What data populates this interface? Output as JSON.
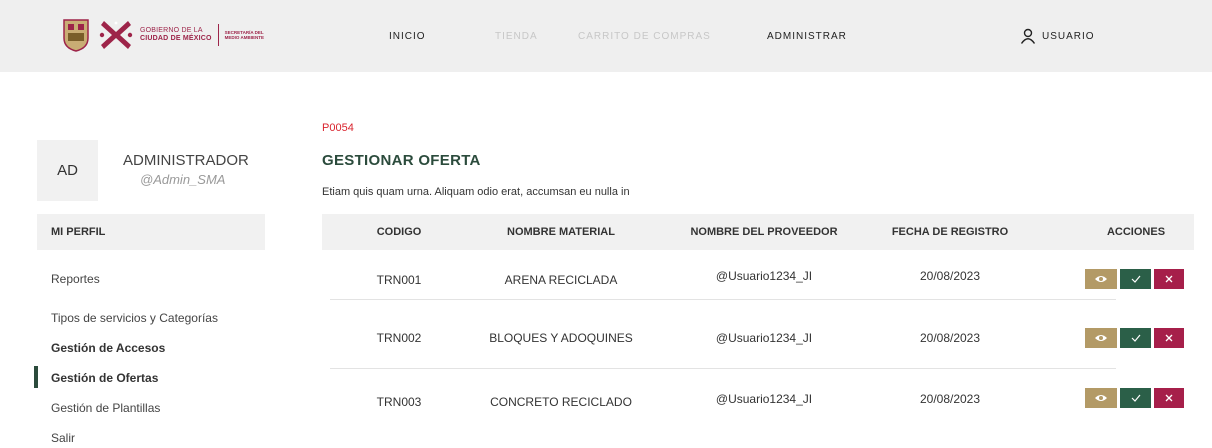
{
  "header": {
    "logo": {
      "gob_line1": "GOBIERNO DE LA",
      "gob_line2": "CIUDAD DE MÉXICO",
      "sec_line1": "SECRETARÍA DEL",
      "sec_line2": "MEDIO AMBIENTE"
    },
    "nav": [
      {
        "label": "INICIO",
        "state": "active"
      },
      {
        "label": "TIENDA",
        "state": "disabled"
      },
      {
        "label": "CARRITO DE COMPRAS",
        "state": "disabled"
      },
      {
        "label": "ADMINISTRAR",
        "state": "active"
      }
    ],
    "user_label": "USUARIO"
  },
  "sidebar": {
    "initials": "AD",
    "name": "ADMINISTRADOR",
    "handle": "@Admin_SMA",
    "section_title": "MI PERFIL",
    "items": [
      {
        "label": "Reportes"
      },
      {
        "label": "Tipos de servicios y Categorías"
      },
      {
        "label": "Gestión de Accesos"
      },
      {
        "label": "Gestión de Ofertas"
      },
      {
        "label": "Gestión de Plantillas"
      },
      {
        "label": "Salir"
      }
    ]
  },
  "main": {
    "code": "P0054",
    "title": "GESTIONAR OFERTA",
    "description": "Etiam quis quam urna. Aliquam odio erat, accumsan eu nulla in",
    "columns": [
      "CODIGO",
      "NOMBRE MATERIAL",
      "NOMBRE DEL PROVEEDOR",
      "FECHA DE REGISTRO",
      "ACCIONES"
    ],
    "rows": [
      {
        "codigo": "TRN001",
        "material": "ARENA RECICLADA",
        "proveedor": "@Usuario1234_JI",
        "fecha": "20/08/2023"
      },
      {
        "codigo": "TRN002",
        "material": "BLOQUES Y ADOQUINES",
        "proveedor": "@Usuario1234_JI",
        "fecha": "20/08/2023"
      },
      {
        "codigo": "TRN003",
        "material": "CONCRETO RECICLADO",
        "proveedor": "@Usuario1234_JI",
        "fecha": "20/08/2023"
      }
    ],
    "actions": {
      "view_icon": "eye-icon",
      "accept_icon": "check-icon",
      "reject_icon": "x-icon"
    }
  },
  "colors": {
    "brand_guinda": "#9d2449",
    "brand_green": "#2b4b3c",
    "gold": "#b39a66",
    "code_red": "#d9232d"
  }
}
